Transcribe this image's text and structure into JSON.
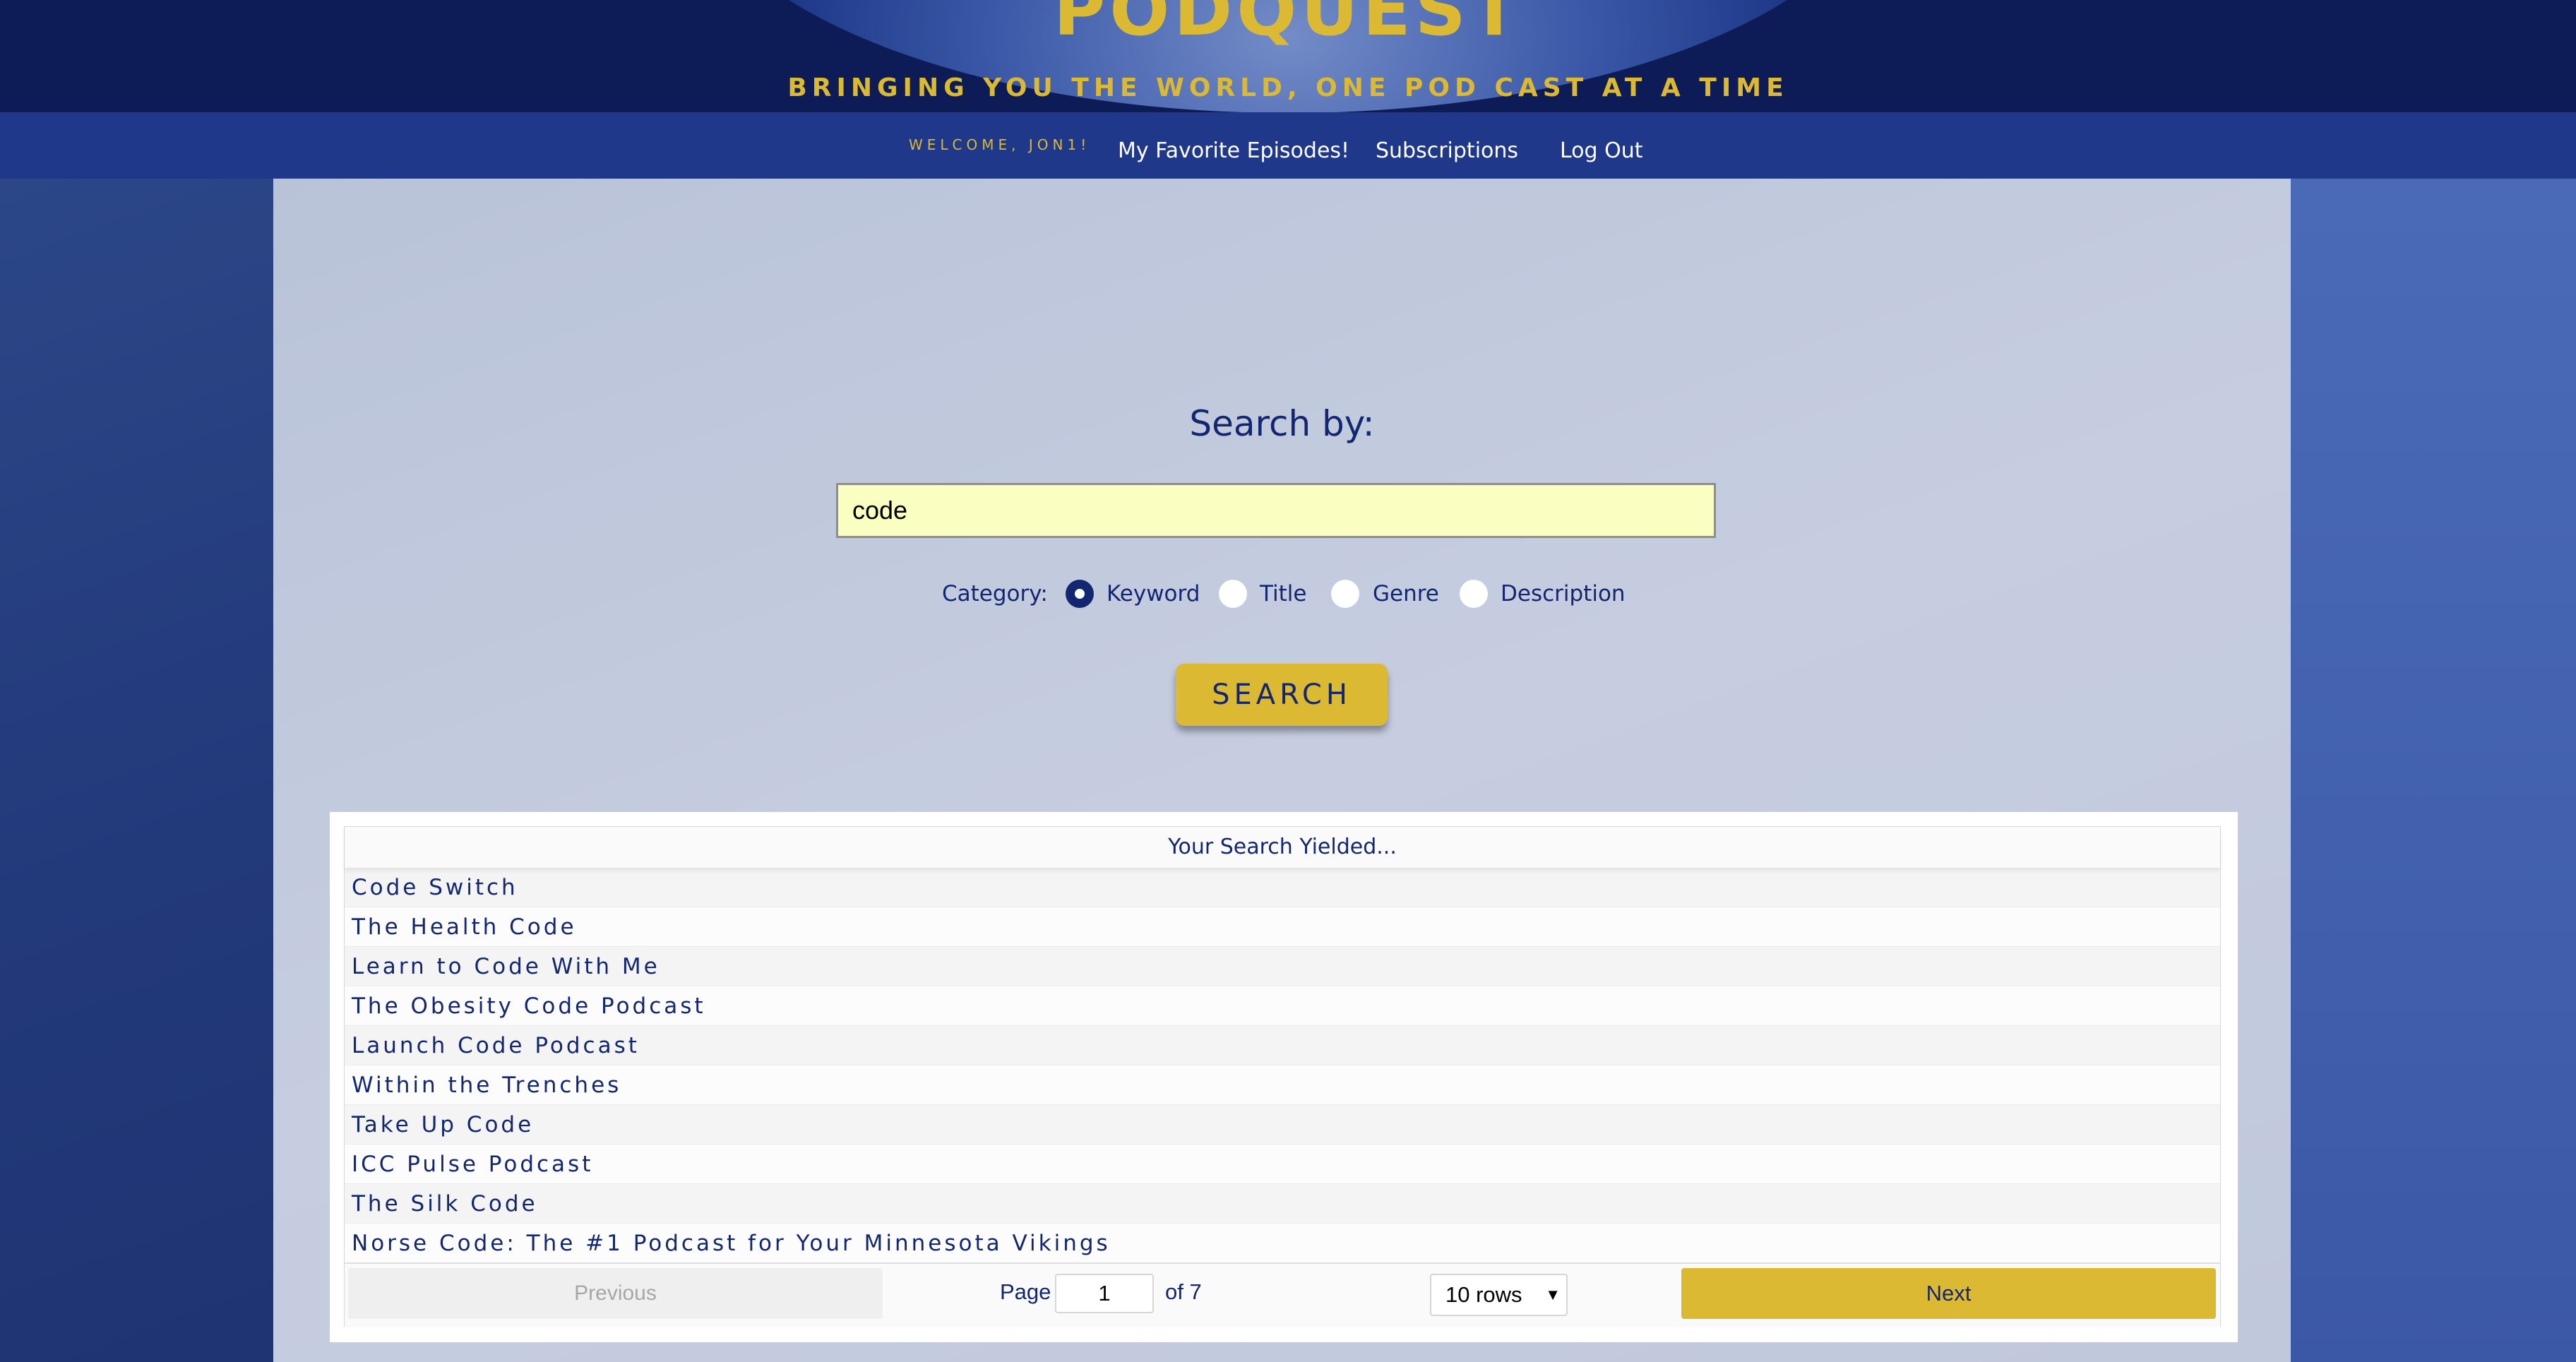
{
  "header": {
    "logo": "PODQUEST",
    "tagline": "BRINGING YOU THE WORLD, ONE POD CAST AT A TIME"
  },
  "nav": {
    "welcome": "WELCOME, JON1!",
    "links": [
      "My Favorite Episodes!",
      "Subscriptions",
      "Log Out"
    ]
  },
  "search": {
    "title": "Search by:",
    "query": "code",
    "button_label": "SEARCH",
    "category_label": "Category:",
    "categories": [
      "Keyword",
      "Title",
      "Genre",
      "Description"
    ],
    "selected_category": "Keyword"
  },
  "results": {
    "header": "Your Search Yielded...",
    "rows": [
      "Code Switch",
      "The Health Code",
      "Learn to Code With Me",
      "The Obesity Code Podcast",
      "Launch Code Podcast",
      "Within the Trenches",
      "Take Up Code",
      "ICC Pulse Podcast",
      "The Silk Code",
      "Norse Code: The #1 Podcast for Your Minnesota Vikings"
    ]
  },
  "pagination": {
    "previous_label": "Previous",
    "page_label": "Page",
    "current_page": "1",
    "of_label": "of 7",
    "rows_selected": "10 rows",
    "next_label": "Next"
  },
  "colors": {
    "navy": "#132770",
    "gold": "#dcb932",
    "input_bg": "#fafec1",
    "header_bg": "#0d1b57",
    "nav_bg": "#1f3889"
  },
  "icons": {
    "select_arrow": "chevron-down-icon"
  }
}
